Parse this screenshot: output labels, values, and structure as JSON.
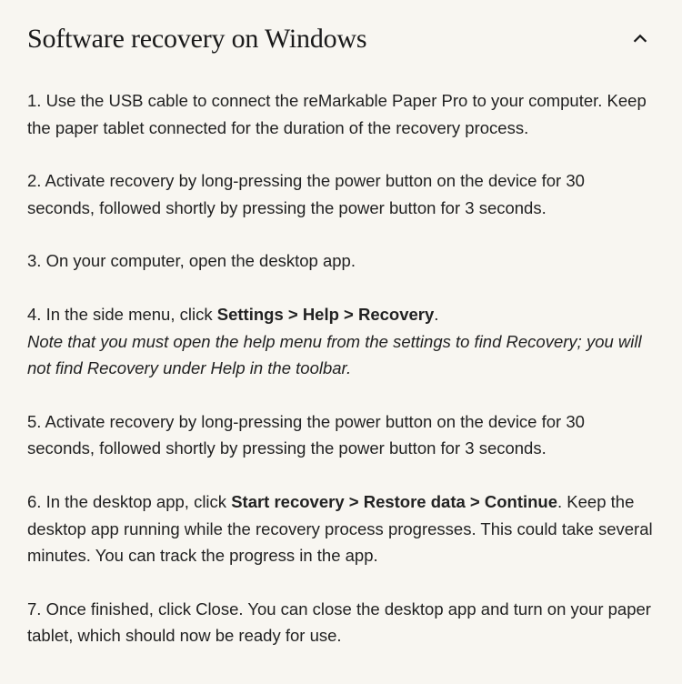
{
  "accordion": {
    "title": "Software recovery on Windows"
  },
  "steps": {
    "s1": "1. Use the USB cable to connect the reMarkable Paper Pro to your computer. Keep the paper tablet connected for the duration of the recovery process.",
    "s2": "2. Activate recovery by long-pressing the power button on the device for 30 seconds, followed shortly by pressing the power button for 3 seconds.",
    "s3": "3. On your computer, open the desktop app.",
    "s4_prefix": "4. In the side menu, click ",
    "s4_bold": "Settings > Help > Recovery",
    "s4_suffix": ".",
    "s4_note": "Note that you must open the help menu from the settings to find Recovery; you will not find Recovery under Help in the toolbar.",
    "s5": "5. Activate recovery by long-pressing the power button on the device for 30 seconds, followed shortly by pressing the power button for 3 seconds.",
    "s6_prefix": "6. In the desktop app, click ",
    "s6_bold": "Start recovery > Restore data > Continue",
    "s6_suffix": ". Keep the desktop app running while the recovery process progresses. This could take several minutes. You can track the progress in the app.",
    "s7": "7. Once finished, click Close. You can close the desktop app and turn on your paper tablet, which should now be ready for use."
  }
}
